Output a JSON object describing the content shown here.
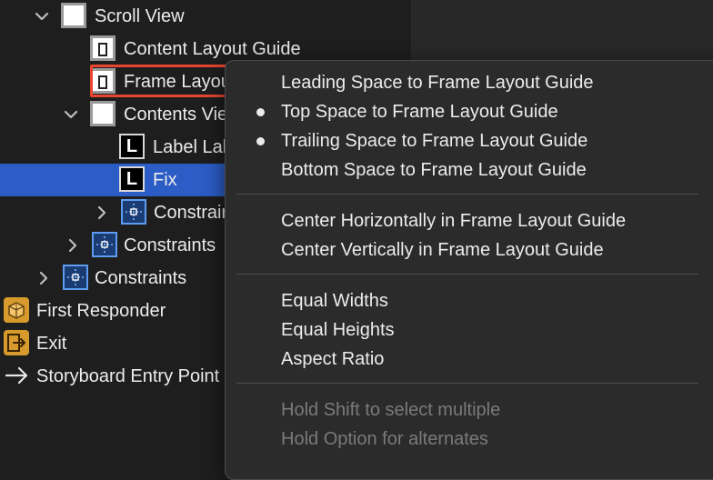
{
  "outline": {
    "rows": [
      {
        "label": "Scroll View"
      },
      {
        "label": "Content Layout Guide"
      },
      {
        "label": "Frame Layout Guide"
      },
      {
        "label": "Contents View"
      },
      {
        "label": "Label Label Label Label"
      },
      {
        "label": "Fix"
      },
      {
        "label": "Constraints"
      },
      {
        "label": "Constraints"
      },
      {
        "label": "Constraints"
      },
      {
        "label": "First Responder"
      },
      {
        "label": "Exit"
      },
      {
        "label": "Storyboard Entry Point"
      }
    ],
    "label_icon_glyph": "L"
  },
  "menu": {
    "items": [
      {
        "label": "Leading Space to Frame Layout Guide",
        "checked": false
      },
      {
        "label": "Top Space to Frame Layout Guide",
        "checked": true
      },
      {
        "label": "Trailing Space to Frame Layout Guide",
        "checked": true
      },
      {
        "label": "Bottom Space to Frame Layout Guide",
        "checked": false
      },
      {
        "label": "Center Horizontally in Frame Layout Guide",
        "checked": false
      },
      {
        "label": "Center Vertically in Frame Layout Guide",
        "checked": false
      },
      {
        "label": "Equal Widths",
        "checked": false
      },
      {
        "label": "Equal Heights",
        "checked": false
      },
      {
        "label": "Aspect Ratio",
        "checked": false
      }
    ],
    "hints": [
      "Hold Shift to select multiple",
      "Hold Option for alternates"
    ]
  },
  "colors": {
    "background": "#1e1e1e",
    "selection": "#2c5cc5",
    "highlight_box": "#e8452e",
    "menu_background": "#2b2b2b"
  }
}
